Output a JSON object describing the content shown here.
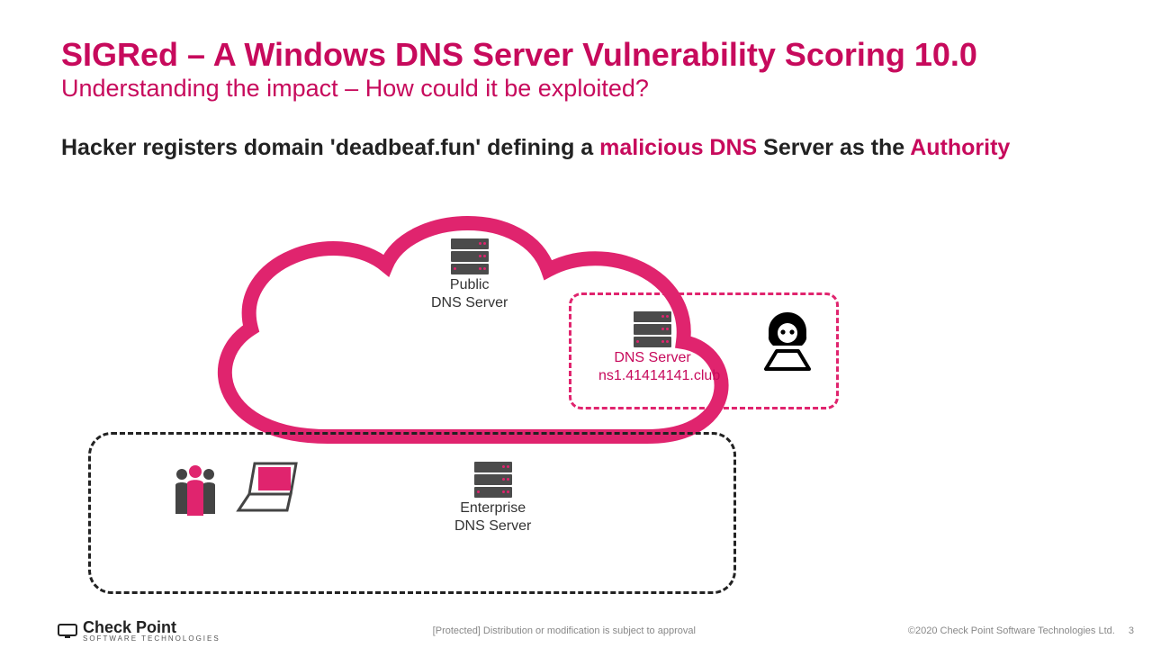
{
  "page": {
    "title": "SIGRed – A Windows DNS Server Vulnerability Scoring 10.0",
    "subtitle": "Understanding the impact – How could it be exploited?"
  },
  "description": {
    "pre": "Hacker registers  domain 'deadbeaf.fun' defining a ",
    "hl1": "malicious DNS",
    "mid": " Server as the ",
    "hl2": "Authority"
  },
  "nodes": {
    "public_dns_l1": "Public",
    "public_dns_l2": "DNS Server",
    "mal_dns_l1": "DNS Server",
    "mal_dns_l2": "ns1.41414141.club",
    "ent_dns_l1": "Enterprise",
    "ent_dns_l2": "DNS Server"
  },
  "icons": {
    "cloud": "cloud",
    "server": "server-rack",
    "hacker": "hacker",
    "users": "users",
    "laptop": "laptop"
  },
  "colors": {
    "accent": "#e0246e",
    "text": "#222"
  },
  "footer": {
    "brand": "Check Point",
    "brand_sub": "SOFTWARE TECHNOLOGIES",
    "classification": "[Protected] Distribution or modification is subject to approval",
    "copyright": "©2020 Check Point Software Technologies Ltd.",
    "page_number": "3"
  }
}
